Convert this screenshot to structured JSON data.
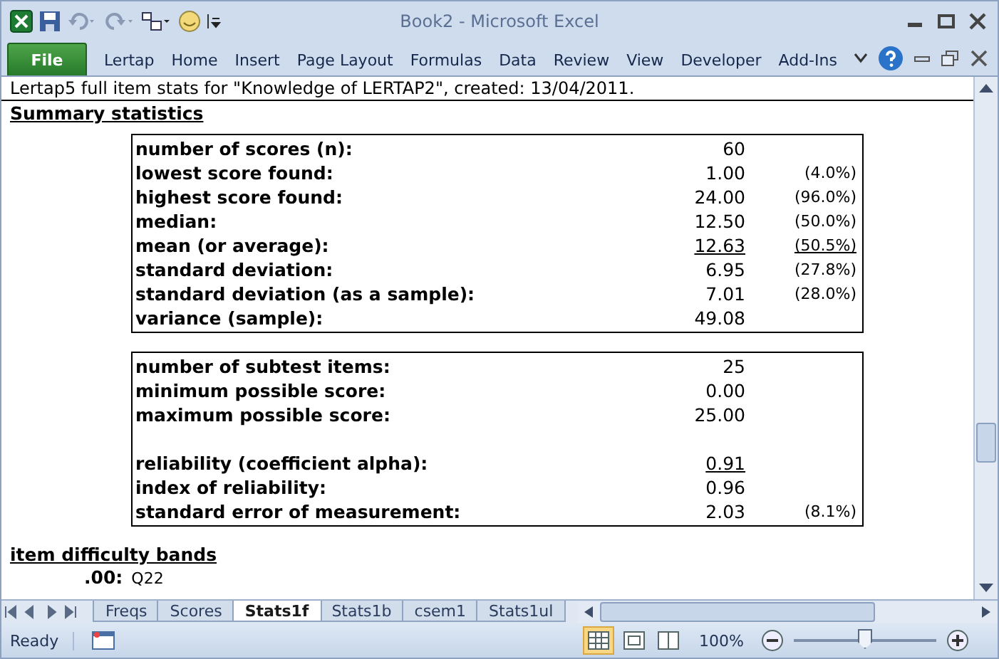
{
  "window": {
    "title": "Book2  -  Microsoft Excel"
  },
  "ribbon_tabs": [
    {
      "label": "File",
      "kind": "file"
    },
    {
      "label": "Lertap",
      "kind": "tab"
    },
    {
      "label": "Home",
      "kind": "tab"
    },
    {
      "label": "Insert",
      "kind": "tab"
    },
    {
      "label": "Page Layout",
      "kind": "tab"
    },
    {
      "label": "Formulas",
      "kind": "tab"
    },
    {
      "label": "Data",
      "kind": "tab"
    },
    {
      "label": "Review",
      "kind": "tab"
    },
    {
      "label": "View",
      "kind": "tab"
    },
    {
      "label": "Developer",
      "kind": "tab"
    },
    {
      "label": "Add-Ins",
      "kind": "tab"
    }
  ],
  "sheet": {
    "header": "Lertap5 full item stats for \"Knowledge of LERTAP2\", created: 13/04/2011.",
    "section_title": "Summary statistics",
    "boxes": [
      {
        "rows": [
          {
            "kind": "stat",
            "label": "number of scores (n):",
            "value": "60",
            "underlined": false
          },
          {
            "kind": "stat",
            "label": "lowest score found:",
            "value": "1.00",
            "percent": "(4.0%)",
            "underlined": false
          },
          {
            "kind": "stat",
            "label": "highest score found:",
            "value": "24.00",
            "percent": "(96.0%)",
            "underlined": false
          },
          {
            "kind": "stat",
            "label": "median:",
            "value": "12.50",
            "percent": "(50.0%)",
            "underlined": false
          },
          {
            "kind": "stat",
            "label": "mean (or average):",
            "value": "12.63",
            "percent": "(50.5%)",
            "underlined": true
          },
          {
            "kind": "stat",
            "label": "standard deviation:",
            "value": "6.95",
            "percent": "(27.8%)",
            "underlined": false
          },
          {
            "kind": "stat",
            "label": "standard deviation (as a sample):",
            "value": "7.01",
            "percent": "(28.0%)",
            "underlined": false
          },
          {
            "kind": "stat",
            "label": "variance (sample):",
            "value": "49.08",
            "underlined": false
          }
        ]
      },
      {
        "rows": [
          {
            "kind": "stat",
            "label": "number of subtest items:",
            "value": "25",
            "underlined": false
          },
          {
            "kind": "stat",
            "label": "minimum possible score:",
            "value": "0.00",
            "underlined": false
          },
          {
            "kind": "stat",
            "label": "maximum possible score:",
            "value": "25.00",
            "underlined": false
          },
          {
            "kind": "blank"
          },
          {
            "kind": "stat",
            "label": "reliability (coefficient alpha):",
            "value": "0.91",
            "underlined": true
          },
          {
            "kind": "stat",
            "label": "index of reliability:",
            "value": "0.96",
            "underlined": false
          },
          {
            "kind": "stat",
            "label": "standard error of measurement:",
            "value": "2.03",
            "percent": "(8.1%)",
            "underlined": false
          }
        ]
      }
    ],
    "bands_title": "item difficulty bands",
    "band": {
      "label": ".00:",
      "items": "Q22"
    }
  },
  "sheet_tabs": [
    {
      "label": "Freqs",
      "selected": false
    },
    {
      "label": "Scores",
      "selected": false
    },
    {
      "label": "Stats1f",
      "selected": true
    },
    {
      "label": "Stats1b",
      "selected": false
    },
    {
      "label": "csem1",
      "selected": false
    },
    {
      "label": "Stats1ul",
      "selected": false
    }
  ],
  "status_bar": {
    "status": "Ready",
    "zoom": "100%",
    "zoom_slider": {
      "level": 0.5
    }
  }
}
